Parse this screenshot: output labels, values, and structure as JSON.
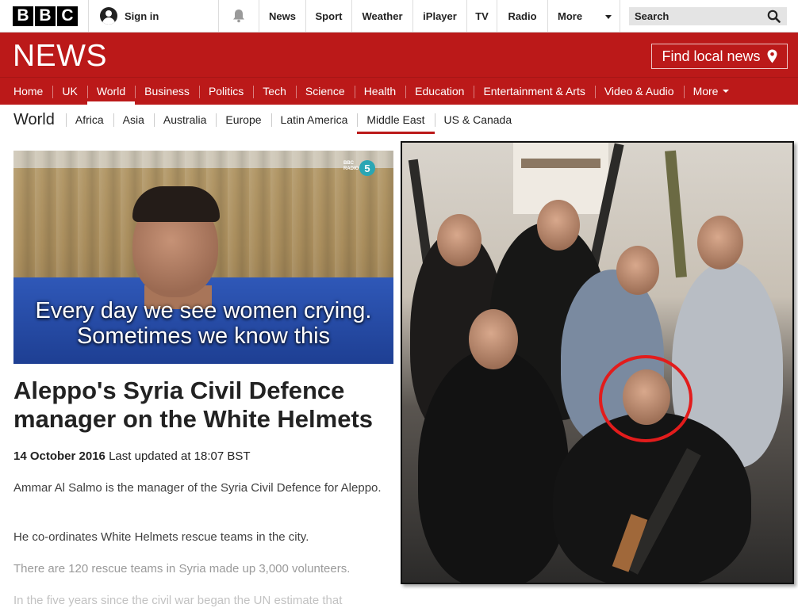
{
  "topbar": {
    "logo_letters": [
      "B",
      "B",
      "C"
    ],
    "sign_in": "Sign in",
    "nav": [
      "News",
      "Sport",
      "Weather",
      "iPlayer",
      "TV",
      "Radio"
    ],
    "more": "More",
    "search_label": "Search"
  },
  "newsbar": {
    "title": "NEWS",
    "local_news": "Find local news"
  },
  "section_nav": {
    "items": [
      "Home",
      "UK",
      "World",
      "Business",
      "Politics",
      "Tech",
      "Science",
      "Health",
      "Education",
      "Entertainment & Arts",
      "Video & Audio"
    ],
    "more": "More",
    "active": "World"
  },
  "sub_nav": {
    "title": "World",
    "items": [
      "Africa",
      "Asia",
      "Australia",
      "Europe",
      "Latin America",
      "Middle East",
      "US & Canada"
    ],
    "active": "Middle East"
  },
  "video": {
    "caption_line1": "Every day we see women crying.",
    "caption_line2": "Sometimes we know this"
  },
  "article": {
    "headline": "Aleppo's Syria Civil Defence manager on the White Helmets",
    "date": "14 October 2016",
    "updated": "Last updated at 18:07 BST",
    "paragraphs": [
      "Ammar Al Salmo is the manager of the Syria Civil Defence for Aleppo.",
      "He co-ordinates White Helmets rescue teams in the city.",
      "There are 120 rescue teams in Syria made up 3,000 volunteers.",
      "In the five years since the civil war began the UN estimate that"
    ]
  },
  "colors": {
    "brand_red": "#bb1919",
    "circle_red": "#e21c1c"
  },
  "icons": {
    "bell": "bell-icon",
    "search": "search-icon",
    "pin": "location-pin-icon",
    "user": "user-icon"
  }
}
